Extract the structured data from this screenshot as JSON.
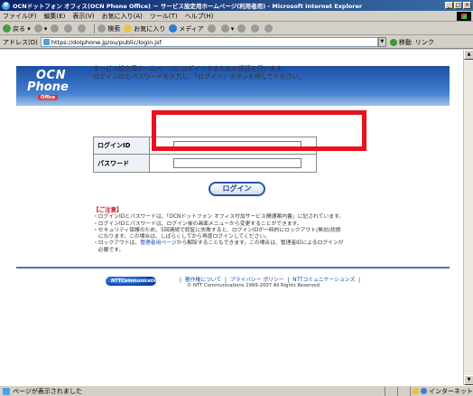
{
  "window": {
    "title": "OCNドットフォン オフィス(OCN Phone Office) － サービス設定用ホームページ(利用者用) - Microsoft Internet Explorer",
    "btn_min": "_",
    "btn_max": "□",
    "btn_close": "×"
  },
  "menu": [
    "ファイル(F)",
    "編集(E)",
    "表示(V)",
    "お気に入り(A)",
    "ツール(T)",
    "ヘルプ(H)"
  ],
  "toolbar": {
    "back": "戻る",
    "search": "検索",
    "favorites": "お気に入り",
    "media": "メディア"
  },
  "address": {
    "label": "アドレス(D)",
    "url": "https://dotphone.jp/ou/public/login.jsf",
    "go": "移動",
    "links": "リンク"
  },
  "header": {
    "logo_line1": "OCN",
    "logo_line2": "Phone",
    "logo_badge": "Office"
  },
  "intro": {
    "line1": "サービス設定用ホームページにログインするための認証を行います。",
    "line2": "ログインIDとパスワードを入力し、「ログイン」ボタンを押してください。"
  },
  "form": {
    "login_id_label": "ログインID",
    "password_label": "パスワード",
    "login_id_value": "",
    "password_value": "",
    "login_button": "ログイン"
  },
  "notes": {
    "title": "【ご注意】",
    "items": [
      "・ログインIDとパスワードは、「OCNドットフォン オフィス付加サービス開通案内書」に記されています。",
      "・ログインIDとパスワードは、ログイン後の画面メニューから変更することができます。",
      "・セキュリティ保護のため、5回連続で認証に失敗すると、ログインIDが一時的にロックアウト(無効)状態",
      "　になります。この場合は、しばらくしてから再度ログインしてください。"
    ],
    "last_item_pre": "・ロックアウトは、",
    "last_item_link": "管理者用ページ",
    "last_item_post": "から解除することもできます。この場合は、管理者IDによるログインが",
    "last_item_cont": "　必要です。"
  },
  "footer": {
    "ntt_logo": "NTTCommunications",
    "link1": "著作権について",
    "link2": "プライバシー ポリシー",
    "link3": "NTTコミュニケーションズ",
    "pipe": "|",
    "copyright": "© NTT Communications 1999-2007 All Rights Reserved"
  },
  "status": {
    "text": "ページが表示されました",
    "zone": "インターネット"
  },
  "colors": {
    "highlight": "#e8121d",
    "banner": "#1d4fa3",
    "link": "#1a49b0"
  }
}
